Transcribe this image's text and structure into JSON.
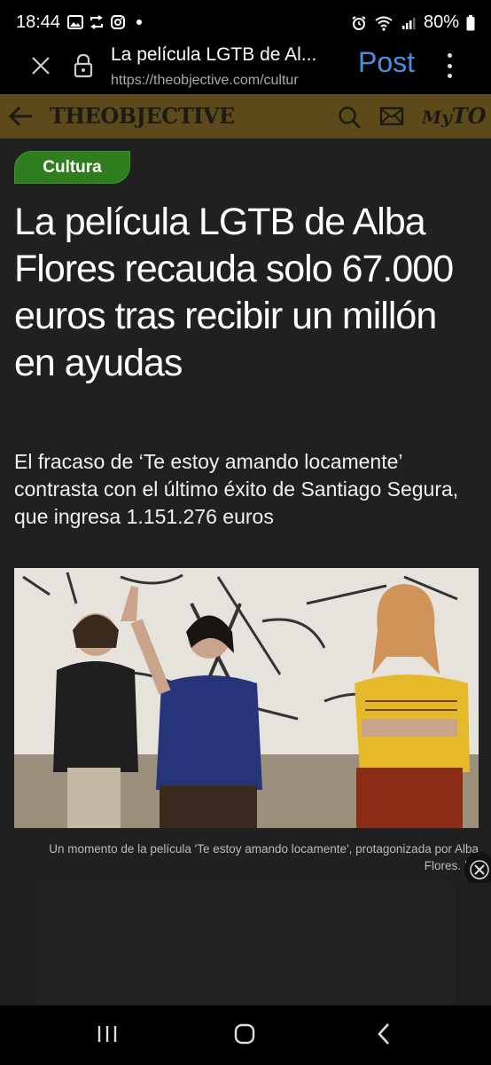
{
  "status_bar": {
    "time": "18:44",
    "left_icons": [
      "gallery-icon",
      "sync-icon",
      "instagram-icon"
    ],
    "right_icons": [
      "alarm-icon",
      "wifi-icon",
      "signal-icon"
    ],
    "battery": "80%"
  },
  "browser": {
    "title": "La película LGTB de Al...",
    "url": "https://theobjective.com/cultur",
    "post_label": "Post"
  },
  "site": {
    "logo": "THEOBJECTIVE",
    "myto_prefix": "My",
    "myto_suffix": "TO"
  },
  "article": {
    "category": "Cultura",
    "headline": "La película LGTB de Alba Flores recauda solo 67.000 euros tras recibir un millón en ayudas",
    "subtitle": "El fracaso de ‘Te estoy amando locamente’ contrasta con el último éxito de Santiago Segura, que ingresa 1.151.276 euros",
    "caption": "Un momento de la película 'Te estoy amando locamente', protagonizada por Alba Flores. | E"
  },
  "colors": {
    "background": "#202020",
    "header_bg": "#5c4a1a",
    "category_green": "#2e7d1e",
    "post_blue": "#4a90e2"
  }
}
